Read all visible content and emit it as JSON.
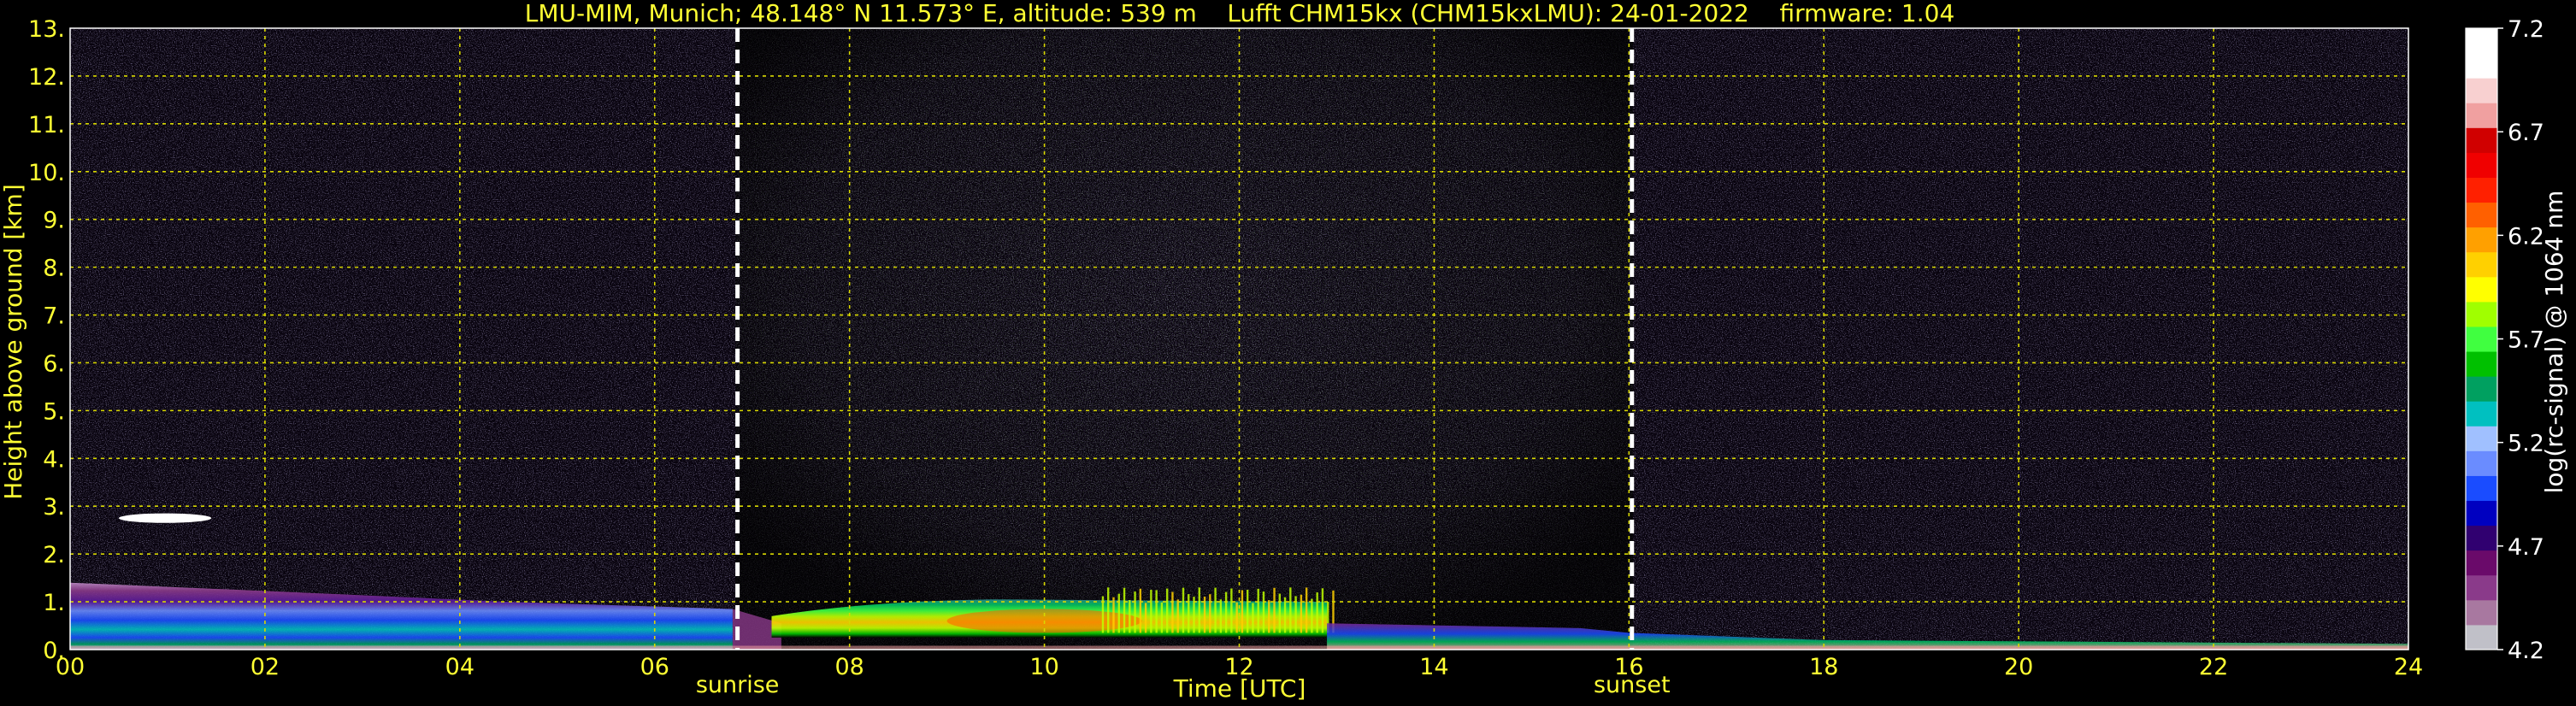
{
  "chart_data": {
    "type": "heatmap",
    "title": "LMU-MIM, Munich; 48.148° N 11.573° E, altitude: 539 m    Lufft CHM15kx (CHM15kxLMU): 24-01-2022    firmware: 1.04",
    "xlabel": "Time [UTC]",
    "ylabel": "Height above ground [km]",
    "xlim": [
      0,
      24
    ],
    "ylim": [
      0,
      13
    ],
    "x_ticks": [
      "00",
      "02",
      "04",
      "06",
      "08",
      "10",
      "12",
      "14",
      "16",
      "18",
      "20",
      "22",
      "24"
    ],
    "y_ticks": [
      "0.",
      "1.",
      "2.",
      "3.",
      "4.",
      "5.",
      "6.",
      "7.",
      "8.",
      "9.",
      "10.",
      "11.",
      "12.",
      "13."
    ],
    "grid": true,
    "markers": [
      {
        "label": "sunrise",
        "x": 6.85
      },
      {
        "label": "sunset",
        "x": 16.03
      }
    ],
    "colorbar": {
      "label": "log(rc-signal) @ 1064 nm",
      "range": [
        4.2,
        7.2
      ],
      "ticks": [
        "4.2",
        "4.7",
        "5.2",
        "5.7",
        "6.2",
        "6.7",
        "7.2"
      ],
      "colors": [
        "#c0c0c8",
        "#a878a0",
        "#8a3a8a",
        "#6a0a6a",
        "#300070",
        "#0000c0",
        "#1a4cff",
        "#6a8cff",
        "#a0c0ff",
        "#00c0c0",
        "#00a060",
        "#00c000",
        "#40ff40",
        "#a0ff00",
        "#ffff00",
        "#ffd000",
        "#ffa000",
        "#ff6000",
        "#ff2000",
        "#f00000",
        "#d00000",
        "#f0a0a0",
        "#f8d0d0",
        "#ffffff",
        "#ffffff"
      ]
    },
    "layers": [
      {
        "name": "boundary layer (night)",
        "x_range": [
          0,
          6.8
        ],
        "height_km": [
          0,
          1.4
        ],
        "level": 5.2
      },
      {
        "name": "lofted cloud",
        "x_range": [
          0.5,
          1.45
        ],
        "height_km": [
          2.65,
          2.85
        ],
        "level": 7.0
      },
      {
        "name": "daytime aerosol layer",
        "x_range": [
          7.2,
          12.9
        ],
        "height_km": [
          0.2,
          1.05
        ],
        "level": 5.8
      },
      {
        "name": "surface layer",
        "x_range": [
          12.9,
          24
        ],
        "height_km": [
          0,
          0.55
        ],
        "level": 5.0
      }
    ]
  }
}
